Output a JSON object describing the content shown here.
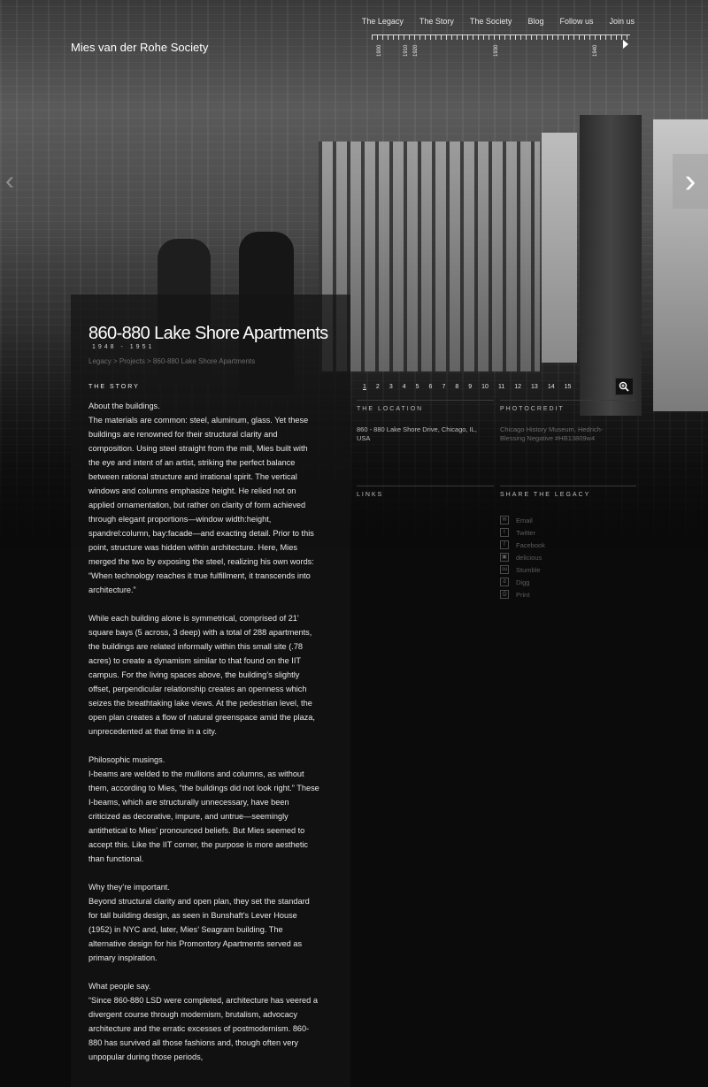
{
  "header": {
    "brand": "Mies van der Rohe Society",
    "nav": [
      "The Legacy",
      "The Story",
      "The Society",
      "Blog",
      "Follow us",
      "Join us"
    ],
    "timeline_years": [
      "1900",
      "1910",
      "1920",
      "1930",
      "1940"
    ]
  },
  "project": {
    "title": "860-880 Lake Shore Apartments",
    "years": "1948 - 1951",
    "breadcrumb": "Legacy > Projects > 860-880 Lake Shore Apartments"
  },
  "story": {
    "heading": "THE STORY",
    "paragraphs": [
      "About the buildings.\nThe materials are common: steel, aluminum, glass. Yet these buildings are renowned for their structural clarity and composition. Using steel straight from the mill, Mies built with the eye and intent of an artist, striking the perfect balance between rational structure and irrational spirit. The vertical windows and columns emphasize height. He relied not on applied ornamentation, but rather on clarity of form achieved through elegant proportions—window width:height, spandrel:column, bay:facade—and exacting detail. Prior to this point, structure was hidden within architecture. Here, Mies merged the two by exposing the steel, realizing his own words: “When technology reaches it true fulfillment, it transcends into architecture.”",
      "While each building alone is symmetrical, comprised of 21' square bays (5 across, 3 deep) with a total of 288 apartments, the buildings are related informally within this small site (.78 acres) to create a dynamism similar to that found on the IIT campus. For the living spaces above, the building’s slightly offset, perpendicular relationship creates an openness which seizes the breathtaking lake views. At the pedestrian level, the open plan creates a flow of natural greenspace amid the plaza, unprecedented at that time in a city.",
      "Philosophic musings.\nI-beams are welded to the mullions and columns, as without them, according to Mies, “the buildings did not look right.” These I-beams, which are structurally unnecessary, have been criticized as decorative, impure, and untrue—seemingly antithetical to Mies’ pronounced beliefs. But Mies seemed to accept this. Like the IIT corner, the purpose is more aesthetic than functional.",
      "Why they’re important.\nBeyond structural clarity and open plan, they set the standard for tall building design, as seen in Bunshaft’s Lever House (1952) in NYC and, later, Mies’ Seagram building. The alternative design for his Promontory Apartments served as primary inspiration.",
      "What people say.\n“Since 860-880 LSD were completed, architecture has veered a divergent course through modernism, brutalism, advocacy architecture and the erratic excesses of postmodernism. 860-880 has survived all those fashions and, though often very unpopular during those periods,"
    ]
  },
  "gallery": {
    "pages": [
      "1",
      "2",
      "3",
      "4",
      "5",
      "6",
      "7",
      "8",
      "9",
      "10",
      "11",
      "12",
      "13",
      "14",
      "15"
    ],
    "active": "1"
  },
  "meta": {
    "location_h": "THE LOCATION",
    "location_v": "860 - 880 Lake Shore Drive, Chicago, IL, USA",
    "photo_h": "PHOTOCREDIT",
    "photo_v": "Chicago History Museum, Hedrich-Blessing Negative #HB13809w4",
    "links_h": "LINKS",
    "share_h": "SHARE THE LEGACY",
    "share": [
      "Email",
      "Twitter",
      "Facebook",
      "delicious",
      "Stumble",
      "Digg",
      "Print"
    ]
  },
  "icons": {
    "prev": "chevron-left-icon",
    "next": "chevron-right-icon",
    "zoom": "zoom-in-icon",
    "play": "play-icon"
  }
}
